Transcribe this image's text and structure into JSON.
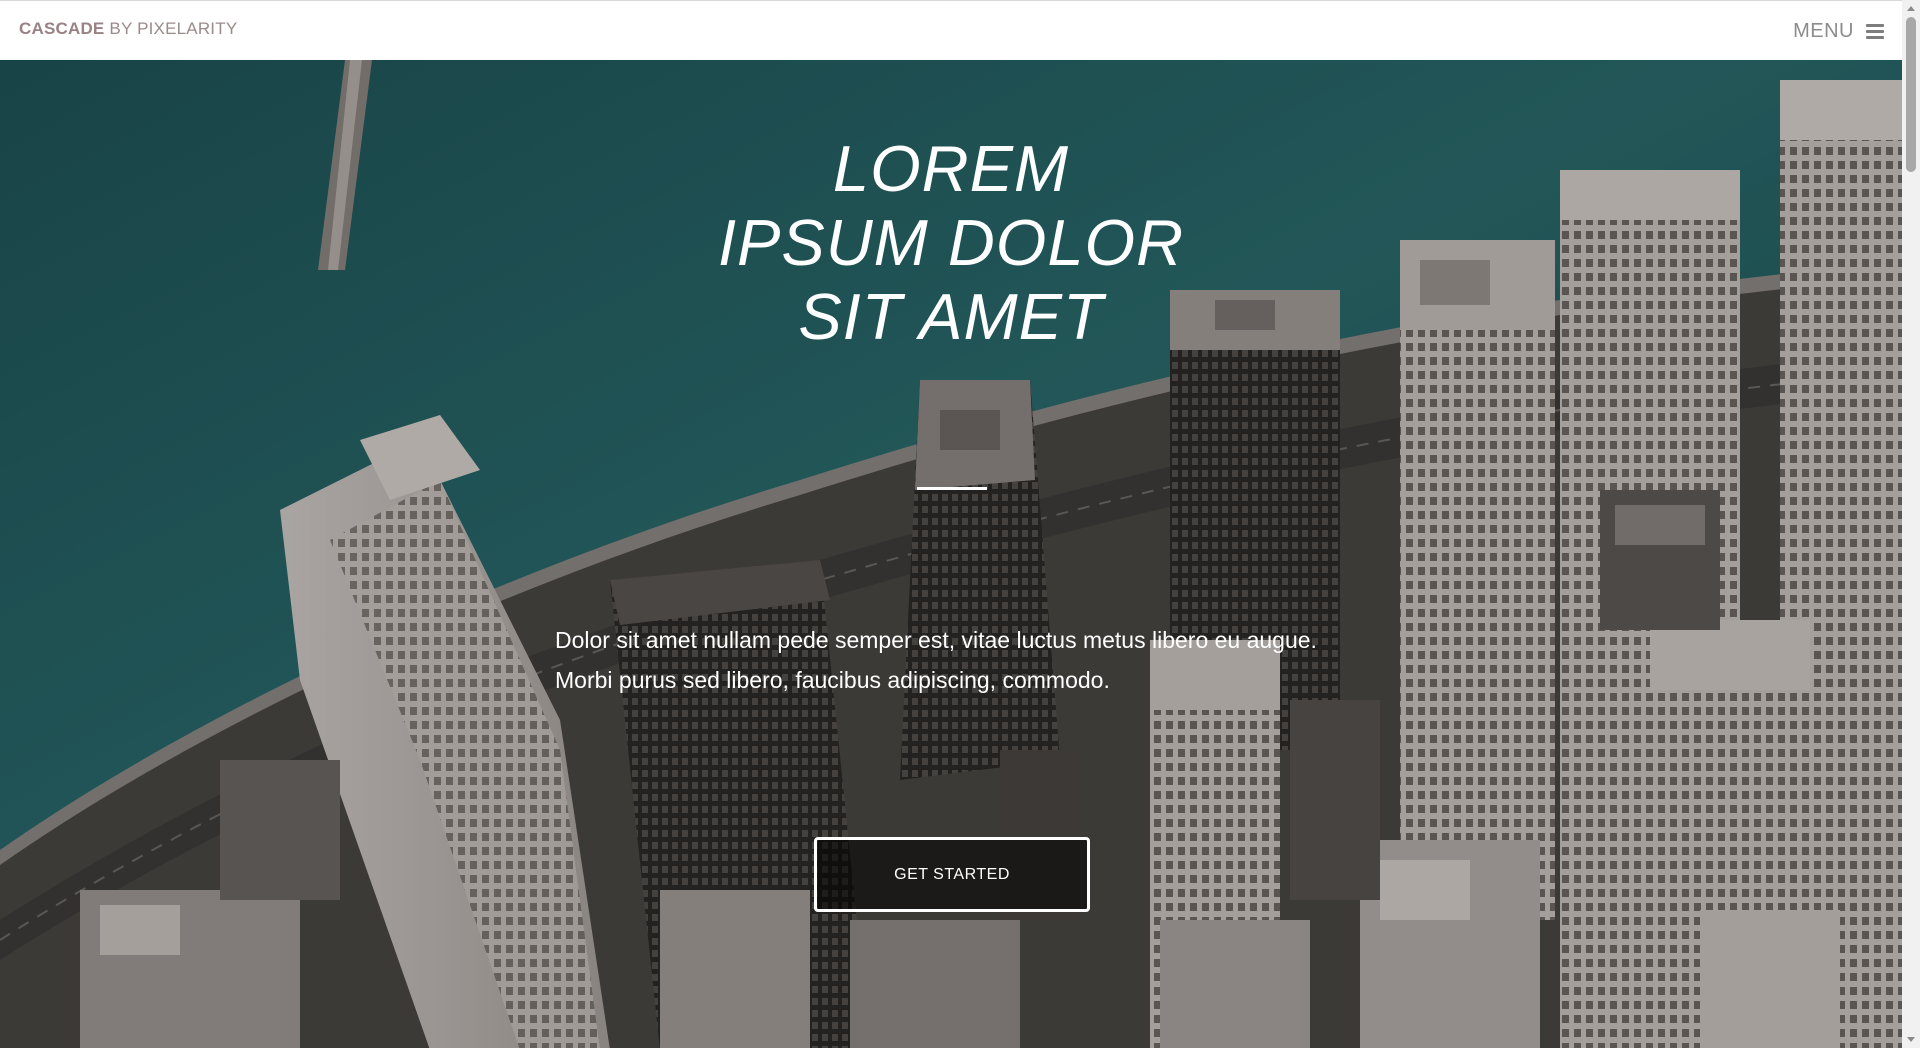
{
  "header": {
    "brand_name": "CASCADE",
    "brand_suffix": "BY PIXELARITY",
    "menu_label": "MENU",
    "menu_icon": "hamburger-icon"
  },
  "hero": {
    "background": "aerial-city-waterfront-photo",
    "title_lines": [
      "LOREM",
      "IPSUM DOLOR",
      "SIT AMET"
    ],
    "text_lines": [
      "Dolor sit amet nullam pede semper est, vitae luctus metus libero eu augue.",
      "Morbi purus sed libero, faucibus adipiscing, commodo."
    ],
    "cta_label": "GET STARTED"
  },
  "colors": {
    "water": "#1f5c60",
    "brand": "#9a8284",
    "text_on_hero": "#ffffff"
  }
}
